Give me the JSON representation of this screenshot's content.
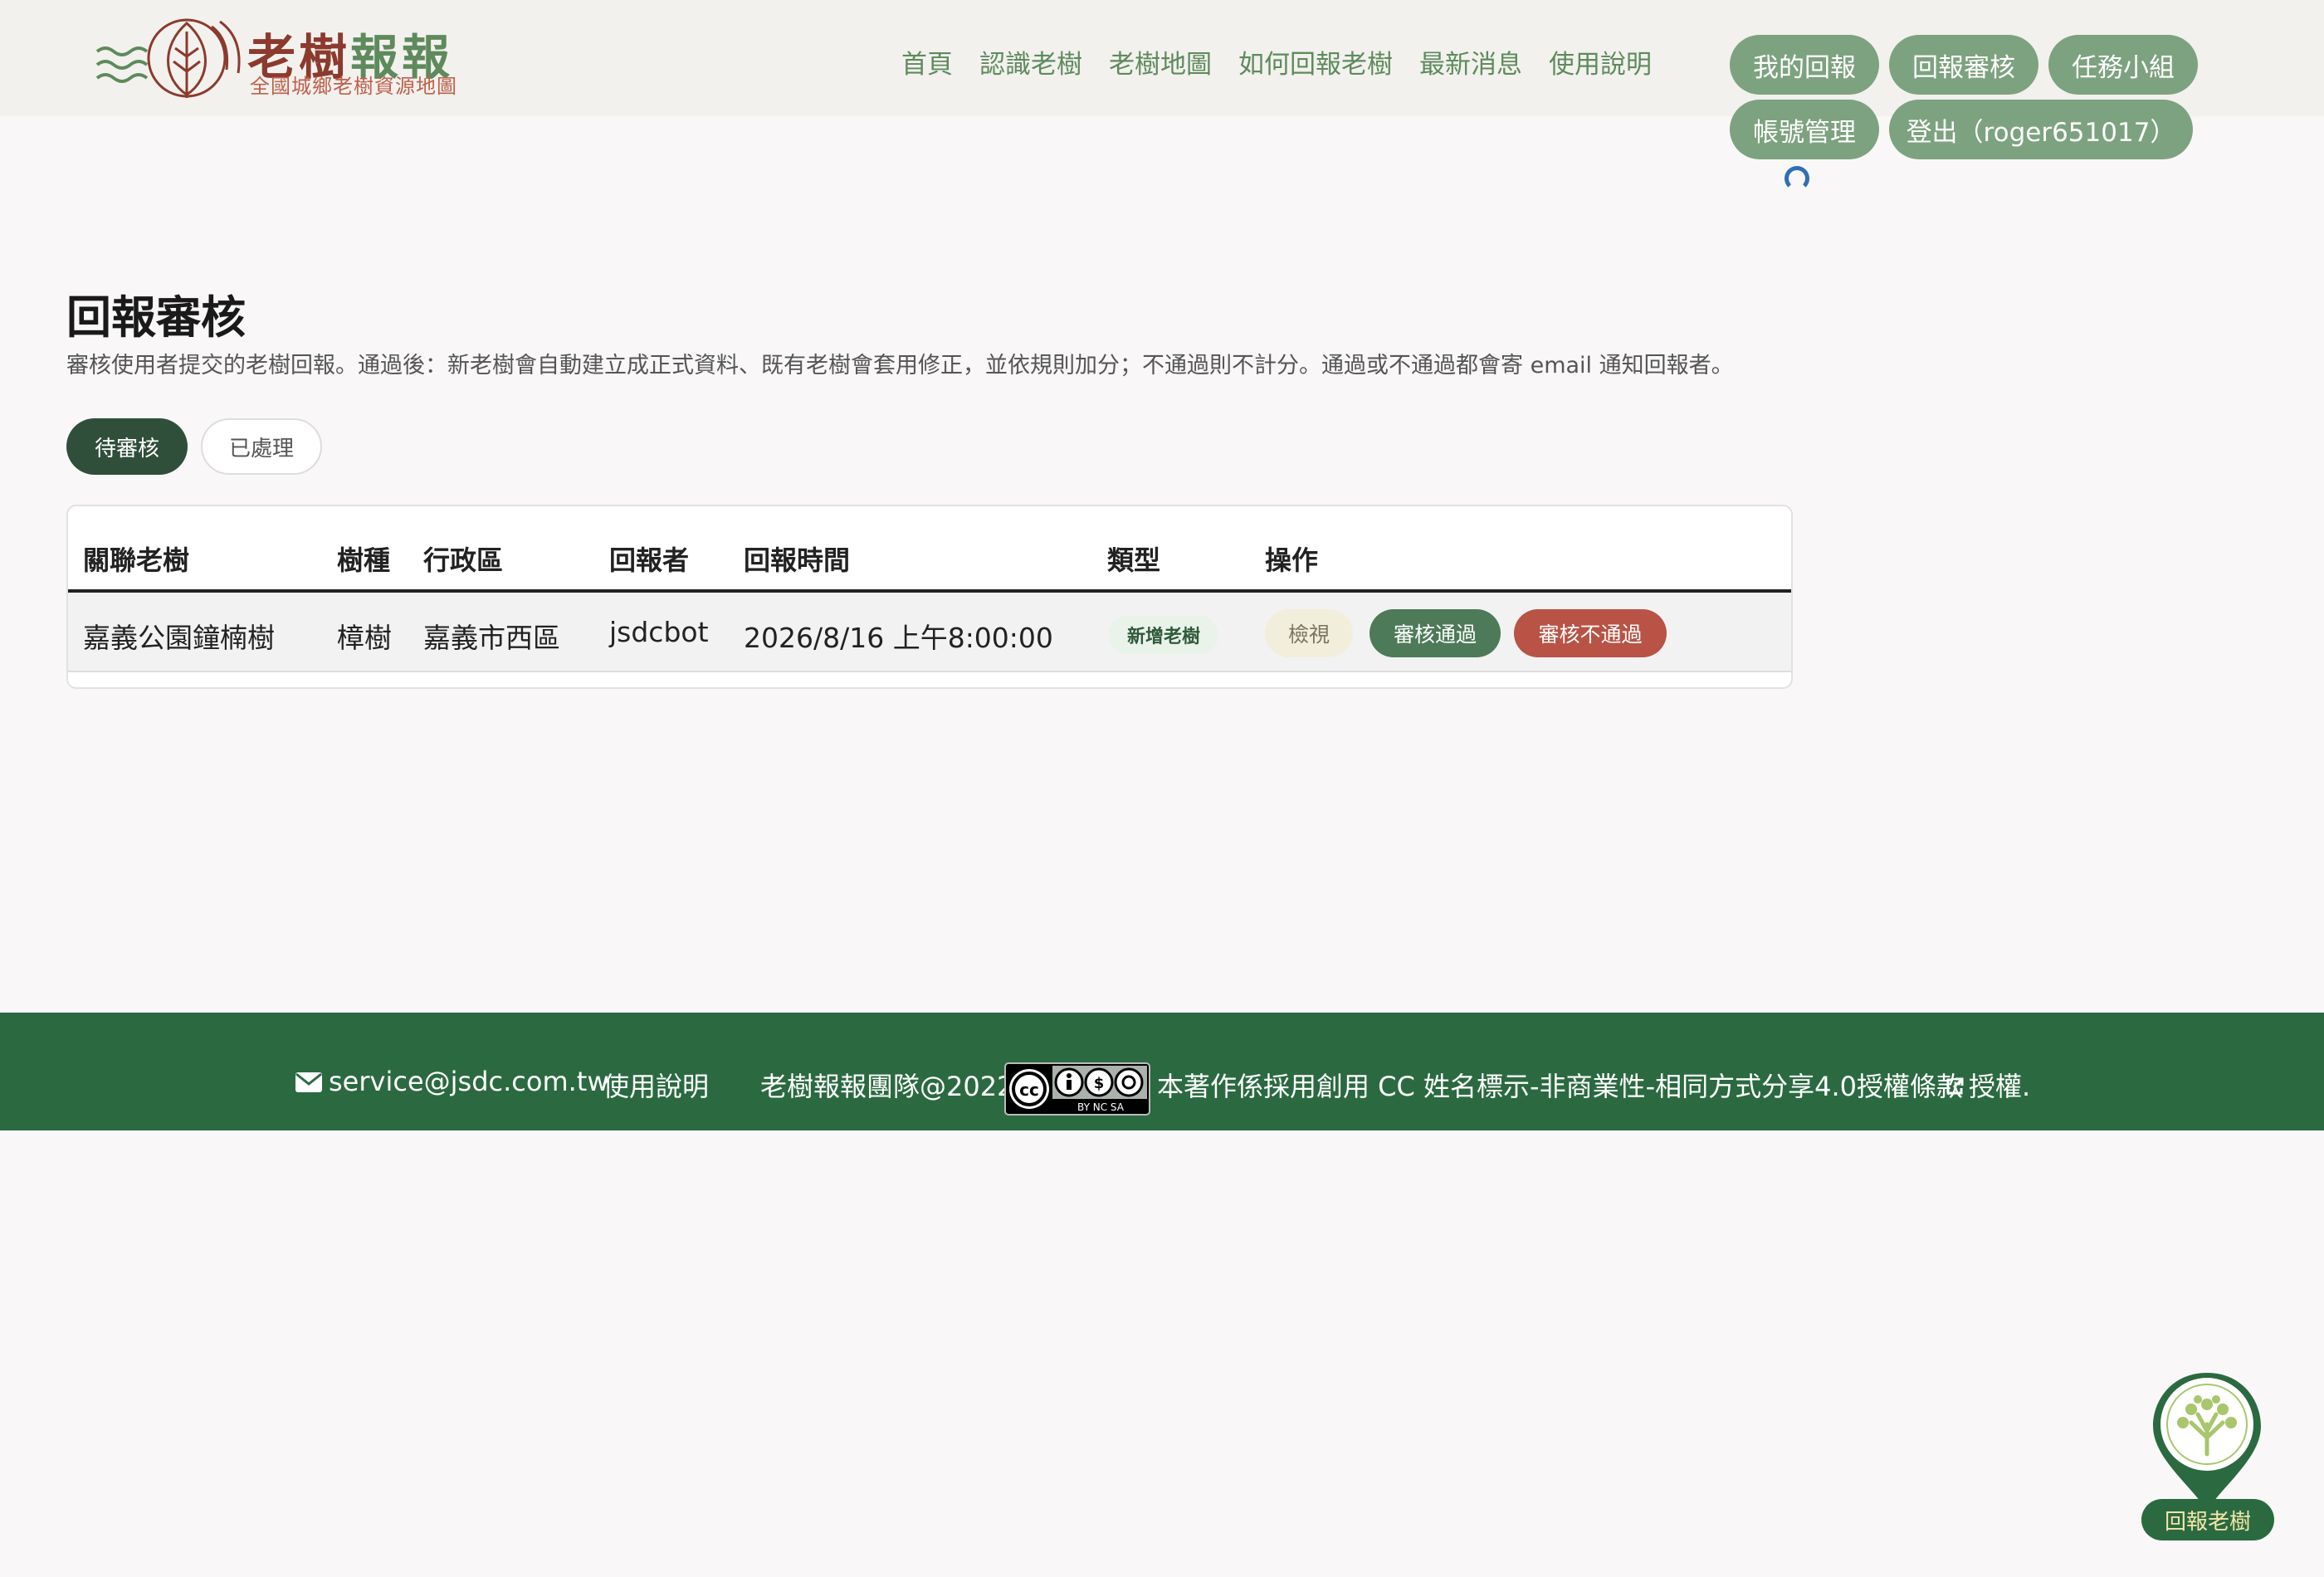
{
  "header": {
    "logo_title_part1": "老樹",
    "logo_title_part2": "報報",
    "logo_subtitle": "全國城鄉老樹資源地圖",
    "nav": [
      "首頁",
      "認識老樹",
      "老樹地圖",
      "如何回報老樹",
      "最新消息",
      "使用說明"
    ],
    "user_menu": {
      "my_reports": "我的回報",
      "review": "回報審核",
      "task_group": "任務小組",
      "account": "帳號管理",
      "logout": "登出（roger651017）"
    }
  },
  "main": {
    "title": "回報審核",
    "description": "審核使用者提交的老樹回報。通過後：新老樹會自動建立成正式資料、既有老樹會套用修正，並依規則加分；不通過則不計分。通過或不通過都會寄 email 通知回報者。",
    "tabs": {
      "pending": "待審核",
      "processed": "已處理"
    },
    "table": {
      "headers": [
        "關聯老樹",
        "樹種",
        "行政區",
        "回報者",
        "回報時間",
        "類型",
        "操作"
      ],
      "rows": [
        {
          "tree": "嘉義公園鐘楠樹",
          "species": "樟樹",
          "district": "嘉義市西區",
          "reporter": "jsdcbot",
          "time": "2026/8/16 上午8:00:00",
          "type": "新增老樹",
          "actions": {
            "view": "檢視",
            "approve": "審核通過",
            "reject": "審核不通過"
          }
        }
      ]
    }
  },
  "footer": {
    "email": "service@jsdc.com.tw",
    "help": "使用說明",
    "team": "老樹報報團隊@2022",
    "license": "本著作係採用創用 CC 姓名標示-非商業性-相同方式分享4.0授權條款",
    "license_suffix": "授權.",
    "cc_badge_text": "BY NC SA"
  },
  "fab": {
    "label": "回報老樹"
  },
  "colors": {
    "header_bg": "#f2f1ee",
    "nav_green": "#5e8a5c",
    "pill_green": "#7da27f",
    "tab_active": "#2f4f3a",
    "approve": "#4d7a58",
    "reject": "#b85345",
    "footer_bg": "#2b6a41",
    "logo_red": "#8c3a2d"
  }
}
